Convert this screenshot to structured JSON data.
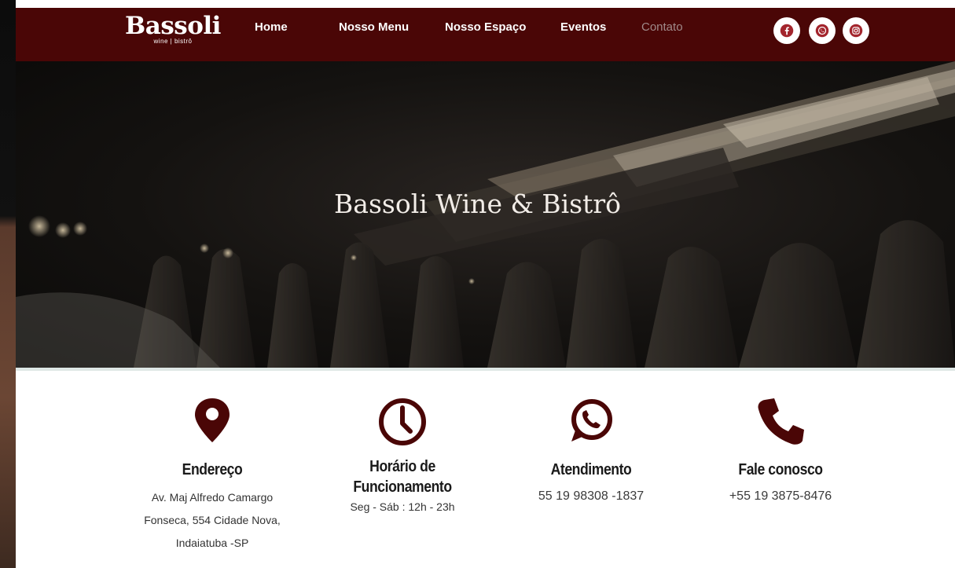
{
  "brand": {
    "name": "Bassoli",
    "tagline": "wine  |  bistrô"
  },
  "nav": {
    "items": [
      {
        "label": "Home"
      },
      {
        "label": "Nosso Menu"
      },
      {
        "label": "Nosso Espaço"
      },
      {
        "label": "Eventos"
      },
      {
        "label": "Contato"
      }
    ],
    "social": [
      "facebook-icon",
      "whatsapp-icon",
      "instagram-icon"
    ]
  },
  "hero": {
    "title": "Bassoli Wine & Bistrô"
  },
  "info": [
    {
      "icon": "location-pin-icon",
      "heading": "Endereço",
      "lines": [
        "Av. Maj Alfredo Camargo",
        "Fonseca, 554 Cidade Nova,",
        "Indaiatuba -SP"
      ]
    },
    {
      "icon": "clock-icon",
      "heading_lines": [
        "Horário de",
        "Funcionamento"
      ],
      "text": "Seg - Sáb : 12h - 23h"
    },
    {
      "icon": "whatsapp-icon",
      "heading": "Atendimento",
      "text": "55 19 98308 -1837"
    },
    {
      "icon": "phone-icon",
      "heading": "Fale conosco",
      "text": "+55 19 3875-8476"
    }
  ],
  "colors": {
    "brand": "#4a0606",
    "accent": "#a3252d",
    "icon": "#4a0606"
  }
}
